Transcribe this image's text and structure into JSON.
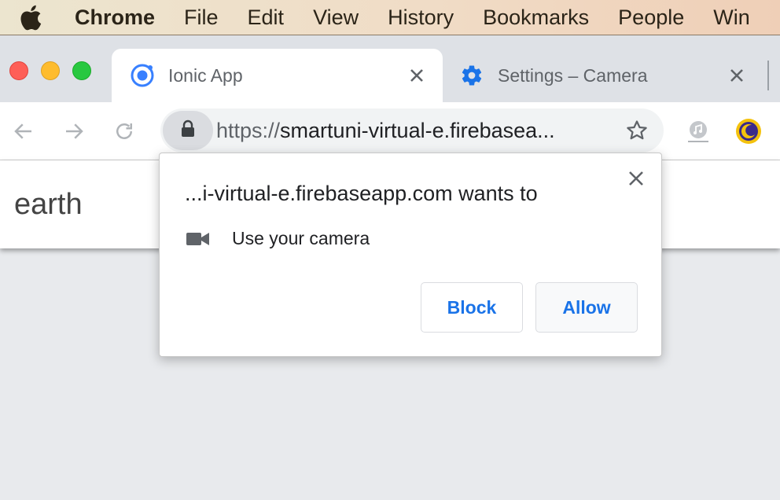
{
  "menubar": {
    "items": [
      "Chrome",
      "File",
      "Edit",
      "View",
      "History",
      "Bookmarks",
      "People",
      "Win"
    ]
  },
  "tabs": [
    {
      "title": "Ionic App",
      "icon": "ionic-icon"
    },
    {
      "title": "Settings – Camera",
      "icon": "gear-icon"
    }
  ],
  "omnibox": {
    "scheme": "https://",
    "host": "smartuni-virtual-e.firebasea..."
  },
  "page": {
    "title": "earth"
  },
  "permission_prompt": {
    "heading": "...i-virtual-e.firebaseapp.com wants to",
    "permission": "Use your camera",
    "block_label": "Block",
    "allow_label": "Allow"
  },
  "colors": {
    "accent": "#1a73e8",
    "tabstrip": "#dee1e6",
    "close_red": "#fe5f57",
    "minimize_yellow": "#febc2e",
    "zoom_green": "#28c840"
  }
}
